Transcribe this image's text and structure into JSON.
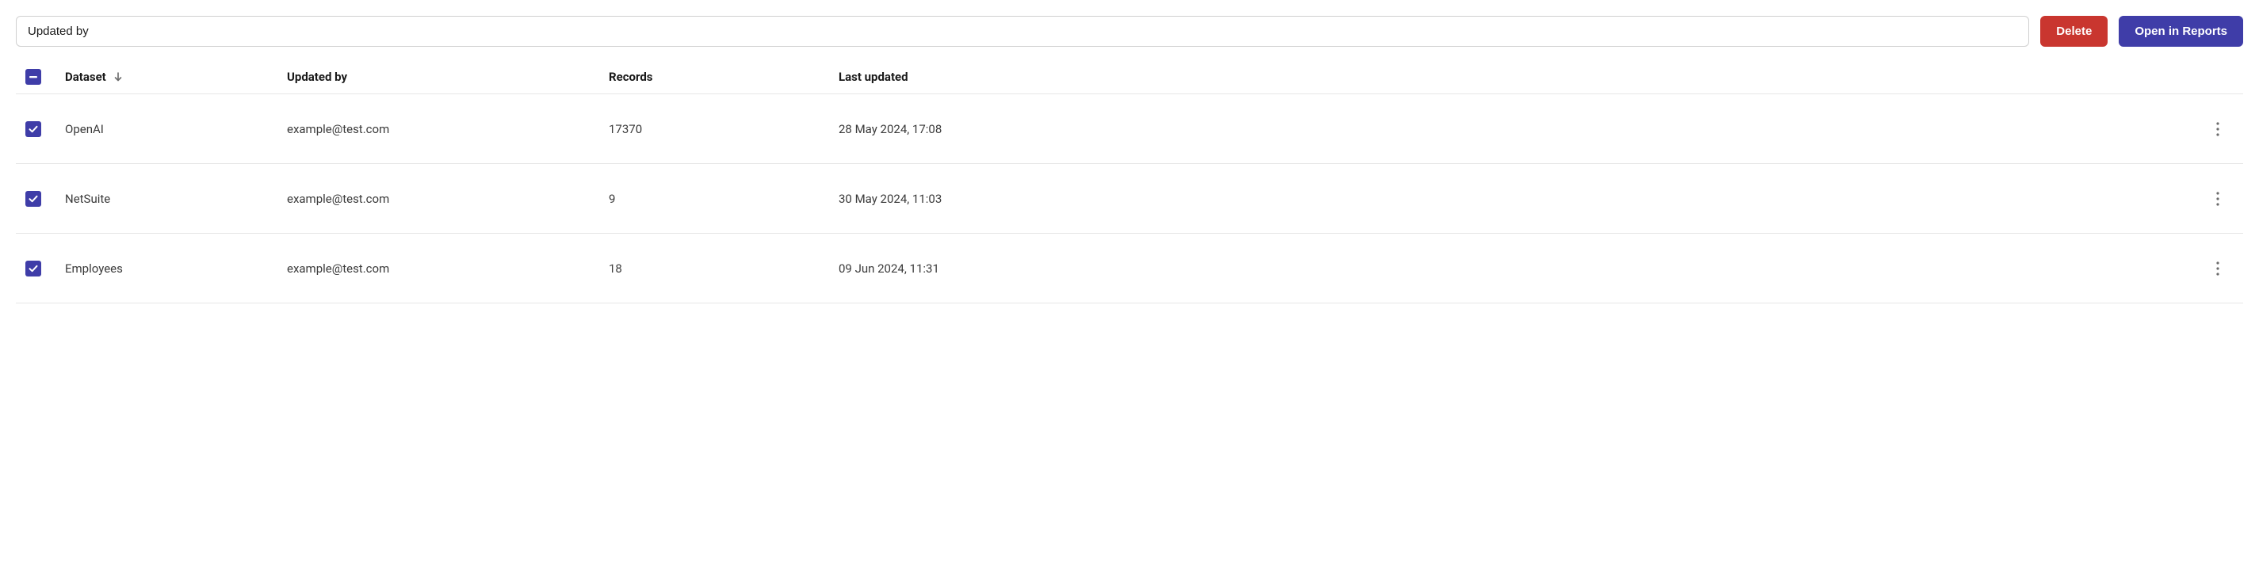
{
  "toolbar": {
    "search_value": "Updated by",
    "delete_label": "Delete",
    "reports_label": "Open in Reports"
  },
  "table": {
    "headers": {
      "dataset": "Dataset",
      "updated_by": "Updated by",
      "records": "Records",
      "last_updated": "Last updated"
    },
    "sort": {
      "column": "dataset",
      "direction": "desc"
    },
    "select_all_state": "indeterminate",
    "rows": [
      {
        "selected": true,
        "dataset": "OpenAI",
        "updated_by": "example@test.com",
        "records": "17370",
        "last_updated": "28 May 2024, 17:08"
      },
      {
        "selected": true,
        "dataset": "NetSuite",
        "updated_by": "example@test.com",
        "records": "9",
        "last_updated": "30 May 2024, 11:03"
      },
      {
        "selected": true,
        "dataset": "Employees",
        "updated_by": "example@test.com",
        "records": "18",
        "last_updated": "09 Jun 2024, 11:31"
      }
    ]
  }
}
